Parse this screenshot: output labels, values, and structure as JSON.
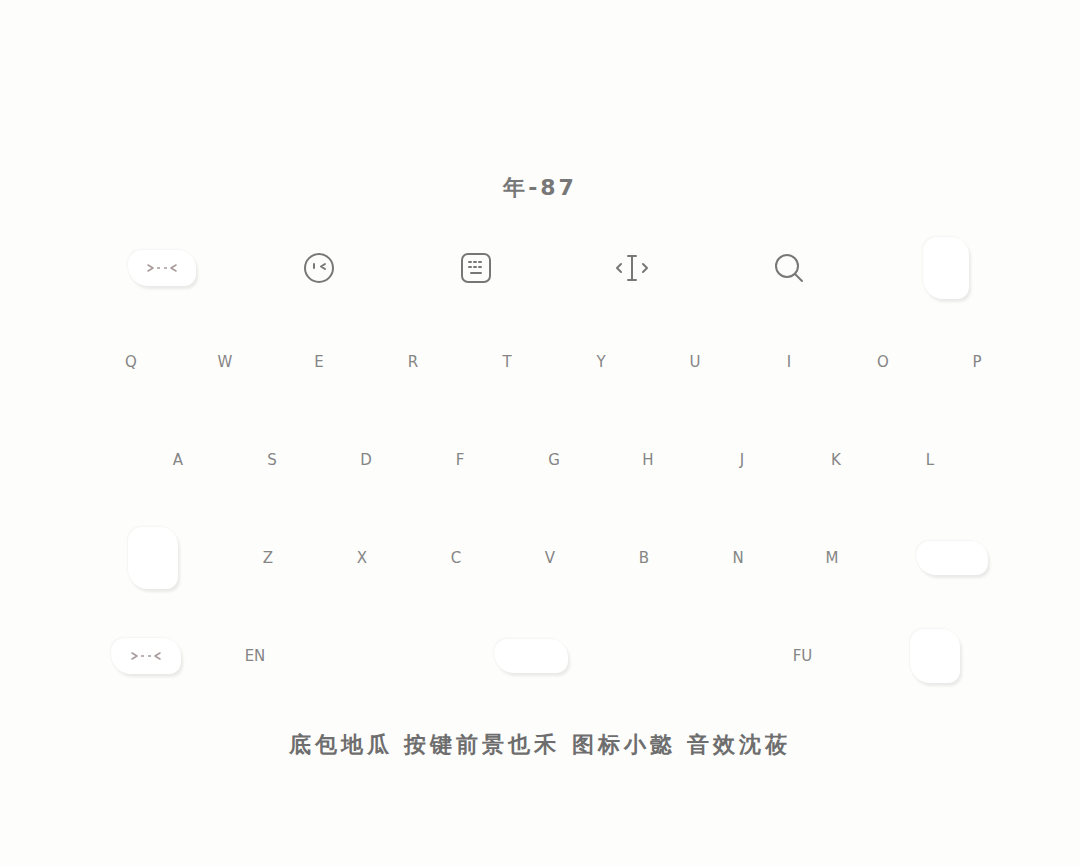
{
  "title": "年-87",
  "toolbar": [
    {
      "kind": "cloud"
    },
    {
      "kind": "emoji"
    },
    {
      "kind": "keyboard"
    },
    {
      "kind": "cursor"
    },
    {
      "kind": "search"
    },
    {
      "kind": "blank"
    }
  ],
  "rows": [
    [
      "Q",
      "W",
      "E",
      "R",
      "T",
      "Y",
      "U",
      "I",
      "O",
      "P"
    ],
    [
      "A",
      "S",
      "D",
      "F",
      "G",
      "H",
      "J",
      "K",
      "L"
    ],
    [
      "Z",
      "X",
      "C",
      "V",
      "B",
      "N",
      "M"
    ]
  ],
  "bottom_row": {
    "left_key": "EN",
    "right_key": "FU"
  },
  "caption": "底包地瓜 按键前景也禾 图标小懿 音效沈莜"
}
